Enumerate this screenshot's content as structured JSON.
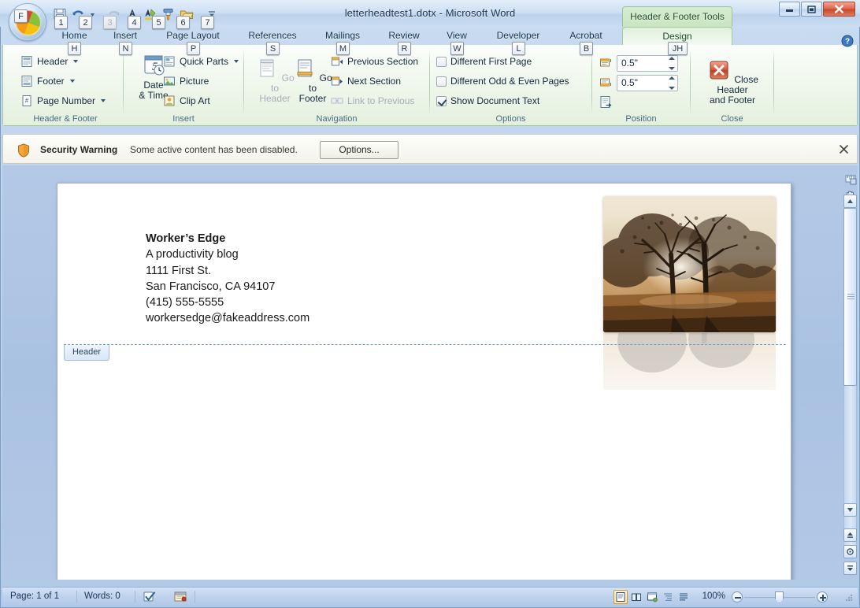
{
  "window": {
    "title": "letterheadtest1.dotx - Microsoft Word",
    "contextual_tab_label": "Header & Footer Tools",
    "minimize_label": "Minimize",
    "restore_label": "Restore",
    "close_label": "Close"
  },
  "office_button": {
    "label": "Office Button",
    "keytip": "F"
  },
  "quick_access": {
    "items": [
      {
        "name": "save-icon",
        "keytip": "1",
        "enabled": true
      },
      {
        "name": "undo-icon",
        "keytip": "2",
        "enabled": true
      },
      {
        "name": "redo-icon",
        "keytip": "3",
        "enabled": false
      },
      {
        "name": "font-color-icon",
        "keytip": "4",
        "enabled": true
      },
      {
        "name": "text-highlight-icon",
        "keytip": "5",
        "enabled": true
      },
      {
        "name": "format-painter-icon",
        "keytip": "6",
        "enabled": true
      },
      {
        "name": "open-icon",
        "keytip": "7",
        "enabled": true
      }
    ],
    "customize_label": "Customize Quick Access Toolbar"
  },
  "ribbon": {
    "tabs": [
      {
        "label": "Home",
        "keytip": "H",
        "active": false
      },
      {
        "label": "Insert",
        "keytip": "N",
        "active": false
      },
      {
        "label": "Page Layout",
        "keytip": "P",
        "active": false
      },
      {
        "label": "References",
        "keytip": "S",
        "active": false
      },
      {
        "label": "Mailings",
        "keytip": "M",
        "active": false
      },
      {
        "label": "Review",
        "keytip": "R",
        "active": false
      },
      {
        "label": "View",
        "keytip": "W",
        "active": false
      },
      {
        "label": "Developer",
        "keytip": "L",
        "active": false
      },
      {
        "label": "Acrobat",
        "keytip": "B",
        "active": false
      },
      {
        "label": "Design",
        "keytip": "JH",
        "active": true
      }
    ],
    "help_label": "Microsoft Office Word Help",
    "groups": {
      "header_footer": {
        "title": "Header & Footer",
        "items": [
          {
            "label": "Header",
            "icon": "header-icon",
            "has_dropdown": true
          },
          {
            "label": "Footer",
            "icon": "footer-icon",
            "has_dropdown": true
          },
          {
            "label": "Page Number",
            "icon": "page-number-icon",
            "has_dropdown": true
          }
        ]
      },
      "insert": {
        "title": "Insert",
        "date_time_label_line1": "Date",
        "date_time_label_line2": "& Time",
        "items": [
          {
            "label": "Quick Parts",
            "icon": "quick-parts-icon",
            "has_dropdown": true
          },
          {
            "label": "Picture",
            "icon": "picture-icon",
            "has_dropdown": false
          },
          {
            "label": "Clip Art",
            "icon": "clip-art-icon",
            "has_dropdown": false
          }
        ]
      },
      "navigation": {
        "title": "Navigation",
        "goto_header_line1": "Go to",
        "goto_header_line2": "Header",
        "goto_footer_line1": "Go to",
        "goto_footer_line2": "Footer",
        "items": [
          {
            "label": "Previous Section",
            "icon": "previous-section-icon",
            "enabled": true
          },
          {
            "label": "Next Section",
            "icon": "next-section-icon",
            "enabled": true
          },
          {
            "label": "Link to Previous",
            "icon": "link-to-previous-icon",
            "enabled": false
          }
        ]
      },
      "options": {
        "title": "Options",
        "items": [
          {
            "label": "Different First Page",
            "checked": false
          },
          {
            "label": "Different Odd & Even Pages",
            "checked": false
          },
          {
            "label": "Show Document Text",
            "checked": true
          }
        ]
      },
      "position": {
        "title": "Position",
        "header_from_top": {
          "label": "Header Position from Top",
          "value": "0.5\""
        },
        "footer_from_bottom": {
          "label": "Footer Position from Bottom",
          "value": "0.5\""
        },
        "insert_alignment_tab": {
          "label": "Insert Alignment Tab",
          "icon": "alignment-tab-icon"
        }
      },
      "close": {
        "title": "Close",
        "button_line1": "Close Header",
        "button_line2": "and Footer",
        "icon": "close-red-x-icon"
      }
    }
  },
  "message_bar": {
    "icon": "security-shield-icon",
    "strong_label": "Security Warning",
    "text": "Some active content has been disabled.",
    "button_label": "Options...",
    "close_label": "Close Message Bar"
  },
  "document": {
    "letterhead": [
      {
        "text": "Worker’s Edge",
        "bold": true
      },
      {
        "text": "A productivity blog",
        "bold": false
      },
      {
        "text": "1111 First St.",
        "bold": false
      },
      {
        "text": "San Francisco, CA 94107",
        "bold": false
      },
      {
        "text": "(415) 555-5555",
        "bold": false
      },
      {
        "text": "workersedge@fakeaddress.com",
        "bold": false
      }
    ],
    "header_tag_label": "Header",
    "photo": {
      "name": "tree-sunset-photo",
      "alt": "Two trees silhouetted against a sepia sunset",
      "colors": {
        "sky": "#efe3cf",
        "ground": "#b07a3c",
        "trees": "#3b2a1c",
        "sun": "#f7ecd2"
      }
    }
  },
  "scrollbar": {
    "ruler_toggle_label": "View Ruler",
    "hand_label": "Select Browse Object",
    "scroll_up_label": "Line Up",
    "scroll_down_label": "Line Down",
    "previous_page_label": "Previous Page",
    "browse_object_label": "Select Browse Object",
    "next_page_label": "Next Page"
  },
  "status_bar": {
    "page_label": "Page: 1 of 1",
    "words_label": "Words: 0",
    "proofing_icon": "spell-check-icon",
    "macro_icon": "record-macro-icon",
    "view_buttons": [
      {
        "name": "print-layout-view",
        "label": "Print Layout",
        "selected": true
      },
      {
        "name": "full-screen-reading-view",
        "label": "Full Screen Reading",
        "selected": false
      },
      {
        "name": "web-layout-view",
        "label": "Web Layout",
        "selected": false
      },
      {
        "name": "outline-view",
        "label": "Outline",
        "selected": false
      },
      {
        "name": "draft-view",
        "label": "Draft",
        "selected": false
      }
    ],
    "zoom_percent": "100%",
    "zoom_out_label": "Zoom Out",
    "zoom_in_label": "Zoom In"
  },
  "colors": {
    "window_chrome": "#bcd3ec",
    "ribbon_green": "#eaf4e6",
    "doc_background": "#aac2e2",
    "accent_blue": "#1b3656",
    "group_title": "#4a6a86",
    "warning_bar": "#f4f3ec"
  }
}
